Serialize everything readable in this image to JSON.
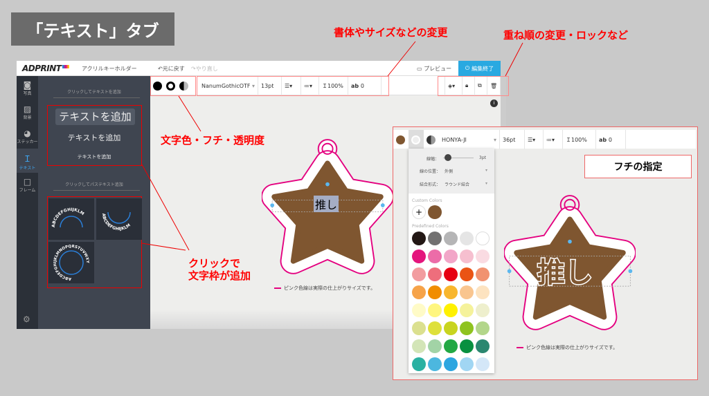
{
  "title": "「テキスト」タブ",
  "annotations": {
    "font": "書体やサイズなどの変更",
    "layer": "重ね順の変更・ロックなど",
    "color": "文字色・フチ・透明度",
    "click1": "クリックで",
    "click2": "文字枠が追加",
    "stroke": "フチの指定"
  },
  "header": {
    "logo": "ADPRINT",
    "product": "アクリルキーホルダー",
    "undo": "元に戻す",
    "redo": "やり直し",
    "preview": "プレビュー",
    "finish": "編集終了"
  },
  "sidebar": [
    {
      "label": "写真",
      "icon": "camera-icon"
    },
    {
      "label": "背景",
      "icon": "pattern-icon"
    },
    {
      "label": "ステッカー",
      "icon": "sticker-icon"
    },
    {
      "label": "テキスト",
      "icon": "text-icon"
    },
    {
      "label": "フレーム",
      "icon": "frame-icon"
    }
  ],
  "panel": {
    "text_heading": "クリックしてテキストを追加",
    "add_large": "テキストを追加",
    "add_medium": "テキストを追加",
    "add_small": "テキストを追加",
    "path_heading": "クリックしてパステキスト追加",
    "path_sample1": "ABCDEFGHIJKLM",
    "path_sample3": "ABCDEFGHIJKLMNOPQRSTUVWXY"
  },
  "toolbar": {
    "font": "NanumGothicOTF",
    "size": "13pt",
    "line_height": "100%",
    "spacing": "0"
  },
  "canvas": {
    "text": "推し",
    "note": "ピンク色線は実際の仕上がりサイズです。"
  },
  "zoomed": {
    "font": "HONYA-JI",
    "size": "36pt",
    "line_height": "100%",
    "spacing": "0",
    "stroke_width_label": "線幅：",
    "stroke_width": "3pt",
    "stroke_pos_label": "線の位置：",
    "stroke_pos": "外側",
    "join_label": "結合形式：",
    "join": "ラウンド結合",
    "custom_colors": "Custom Colors",
    "predefined_colors": "Predefined Colors",
    "add": "+",
    "text": "推し",
    "note": "ピンク色線は実際の仕上がりサイズです。"
  },
  "colors": {
    "text": "#7f5630",
    "outline": "#e4007f",
    "custom": [
      "#7f5630"
    ],
    "predefined": [
      "#231815",
      "#727171",
      "#b5b5b6",
      "#e5e5e5",
      "#ffffff",
      "#e4157d",
      "#ec6ca8",
      "#f2a6c8",
      "#f6bfcf",
      "#fadbe2",
      "#f29c9f",
      "#ee6e7c",
      "#e60012",
      "#ea5414",
      "#f19270",
      "#f6a349",
      "#f18d00",
      "#f8b62d",
      "#f9c58f",
      "#fde3c0",
      "#fffbc7",
      "#fff67f",
      "#fff100",
      "#f5f29b",
      "#eeefcd",
      "#dbe08f",
      "#dee03a",
      "#c8d41f",
      "#8fc31f",
      "#b3d68a",
      "#d3e5b7",
      "#a2d3a6",
      "#22a844",
      "#089040",
      "#2b8770",
      "#2ab1a2",
      "#4cb7df",
      "#2ca6e0",
      "#a1d6f3",
      "#d4e7f8"
    ]
  }
}
